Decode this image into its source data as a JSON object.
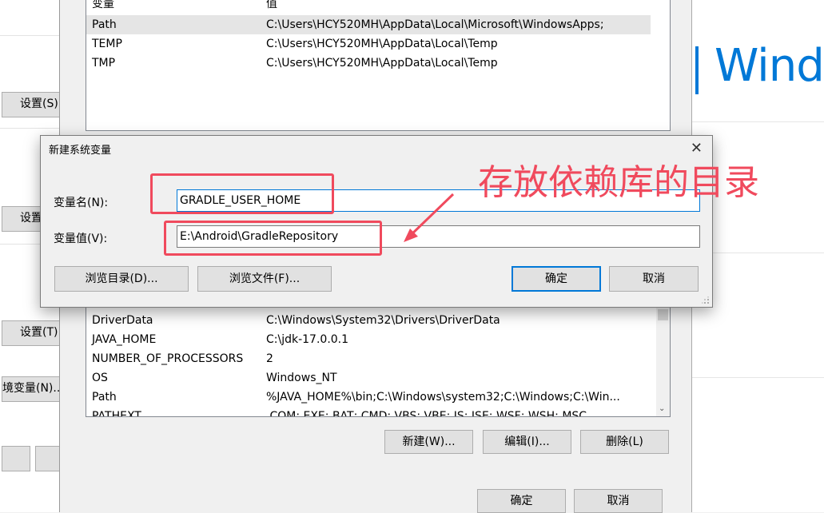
{
  "sysprops": {
    "buttons": [
      "设置(S)",
      "设置",
      "设置(T)",
      "境变量(N)..."
    ]
  },
  "winpanel": {
    "brand": "Wind"
  },
  "user_vars": {
    "headers": [
      "变量",
      "值"
    ],
    "rows": [
      {
        "name": "Path",
        "value": "C:\\Users\\HCY520MH\\AppData\\Local\\Microsoft\\WindowsApps;"
      },
      {
        "name": "TEMP",
        "value": "C:\\Users\\HCY520MH\\AppData\\Local\\Temp"
      },
      {
        "name": "TMP",
        "value": "C:\\Users\\HCY520MH\\AppData\\Local\\Temp"
      }
    ]
  },
  "system_vars": {
    "rows": [
      {
        "name": "DriverData",
        "value": "C:\\Windows\\System32\\Drivers\\DriverData"
      },
      {
        "name": "JAVA_HOME",
        "value": "C:\\jdk-17.0.0.1"
      },
      {
        "name": "NUMBER_OF_PROCESSORS",
        "value": "2"
      },
      {
        "name": "OS",
        "value": "Windows_NT"
      },
      {
        "name": "Path",
        "value": "%JAVA_HOME%\\bin;C:\\Windows\\system32;C:\\Windows;C:\\Win..."
      },
      {
        "name": "PATHEXT",
        "value": ".COM;.EXE;.BAT;.CMD;.VBS;.VBE;.JS;.JSE;.WSF;.WSH;.MSC"
      }
    ],
    "buttons": {
      "new": "新建(W)...",
      "edit": "编辑(I)...",
      "delete": "删除(L)"
    }
  },
  "env_dialog": {
    "ok": "确定",
    "cancel": "取消"
  },
  "new_var_dialog": {
    "title": "新建系统变量",
    "close": "✕",
    "name_label": "变量名(N):",
    "name_value": "GRADLE_USER_HOME",
    "value_label": "变量值(V):",
    "value_value": "E:\\Android\\GradleRepository",
    "browse_dir": "浏览目录(D)...",
    "browse_file": "浏览文件(F)...",
    "ok": "确定",
    "cancel": "取消"
  },
  "annotation": {
    "text": "存放依赖库的目录",
    "color": "#f04a5d"
  }
}
